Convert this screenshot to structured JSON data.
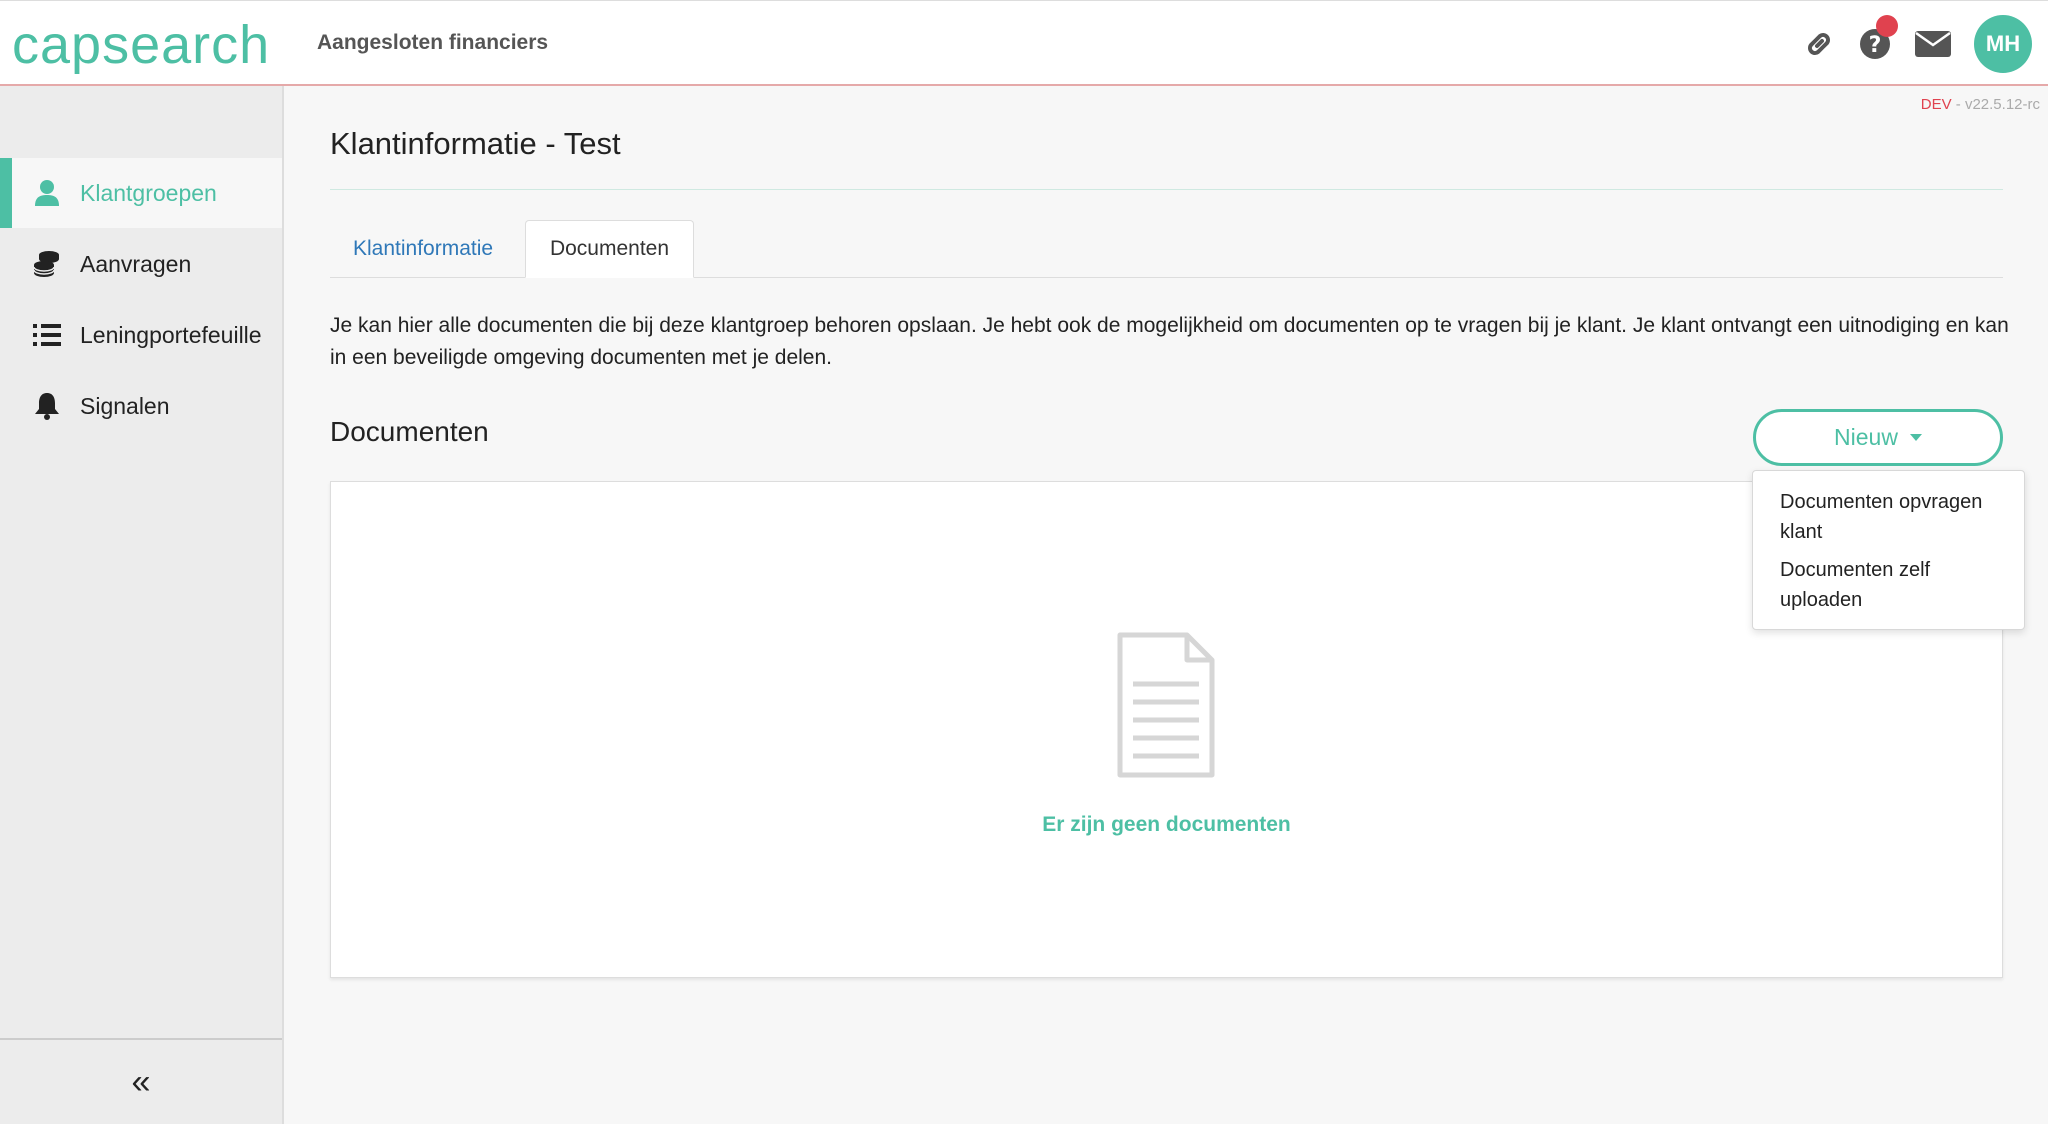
{
  "app": {
    "logo": "capsearch",
    "header_title": "Aangesloten financiers",
    "user_initials": "MH",
    "colors": {
      "accent": "#4dbfa4",
      "link": "#2f78b8",
      "badge": "#e0424f"
    },
    "icons": [
      "link-icon",
      "help-icon",
      "mail-icon"
    ]
  },
  "version": {
    "env": "DEV",
    "separator": " - ",
    "number": "v22.5.12-rc"
  },
  "sidebar": {
    "items": [
      {
        "label": "Klantgroepen",
        "icon": "user-icon",
        "active": true
      },
      {
        "label": "Aanvragen",
        "icon": "coins-icon",
        "active": false
      },
      {
        "label": "Leningportefeuille",
        "icon": "list-icon",
        "active": false
      },
      {
        "label": "Signalen",
        "icon": "bell-icon",
        "active": false
      }
    ],
    "collapse_label": "«"
  },
  "main": {
    "title": "Klantinformatie - Test",
    "tabs": [
      {
        "label": "Klantinformatie",
        "active": false
      },
      {
        "label": "Documenten",
        "active": true
      }
    ],
    "intro": "Je kan hier alle documenten die bij deze klantgroep behoren opslaan. Je hebt ook de mogelijkheid om documenten op te vragen bij je klant. Je klant ontvangt een uitnodiging en kan in een beveiligde omgeving documenten met je delen.",
    "section_title": "Documenten",
    "new_button": "Nieuw",
    "dropdown": [
      {
        "label": "Documenten opvragen klant"
      },
      {
        "label": "Documenten zelf uploaden"
      }
    ],
    "empty_text": "Er zijn geen documenten"
  }
}
